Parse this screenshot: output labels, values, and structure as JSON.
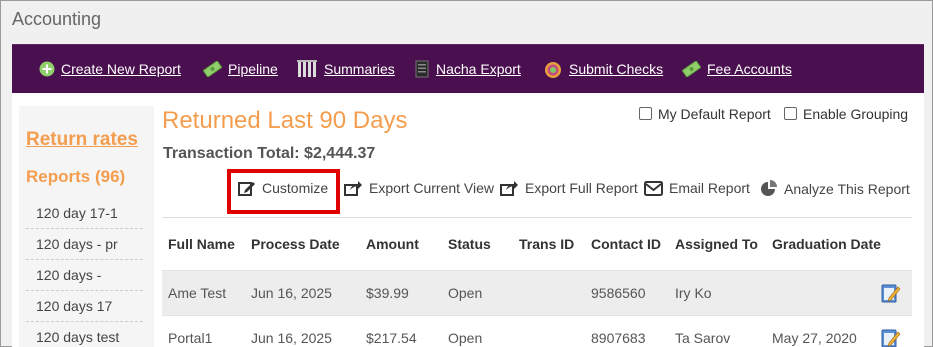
{
  "app": {
    "title": "Accounting"
  },
  "nav": {
    "items": [
      {
        "label": "Create New Report",
        "icon": "plus-circle-icon"
      },
      {
        "label": "Pipeline",
        "icon": "money-icon"
      },
      {
        "label": "Summaries",
        "icon": "columns-icon"
      },
      {
        "label": "Nacha Export",
        "icon": "document-icon"
      },
      {
        "label": "Submit Checks",
        "icon": "target-icon"
      },
      {
        "label": "Fee Accounts",
        "icon": "money-icon"
      }
    ]
  },
  "sidebar": {
    "return_rates_label": "Return rates",
    "reports_heading": "Reports (96)",
    "reports": [
      "120 day 17-1",
      "120 days - pr",
      "120 days -",
      "120 days 17",
      "120 days test"
    ]
  },
  "report": {
    "title": "Returned Last 90 Days",
    "transaction_total": "Transaction Total: $2,444.37",
    "my_default_label": "My Default Report",
    "enable_grouping_label": "Enable Grouping",
    "actions": {
      "customize": "Customize",
      "export_current": "Export Current View",
      "export_full": "Export Full Report",
      "email": "Email Report",
      "analyze": "Analyze This Report"
    },
    "highlight_color": "#e00000",
    "accent_color": "#f49d4e",
    "nav_color": "#4a0f4f"
  },
  "table": {
    "columns": [
      "Full Name",
      "Process Date",
      "Amount",
      "Status",
      "Trans ID",
      "Contact ID",
      "Assigned To",
      "Graduation Date"
    ],
    "rows": [
      [
        "Ame Test",
        "Jun 16, 2025",
        "$39.99",
        "Open",
        "",
        "9586560",
        "Iry Ko",
        ""
      ],
      [
        "Portal1",
        "Jun 16, 2025",
        "$217.54",
        "Open",
        "",
        "8907683",
        "Ta Sarov",
        "May 27, 2020"
      ]
    ]
  }
}
